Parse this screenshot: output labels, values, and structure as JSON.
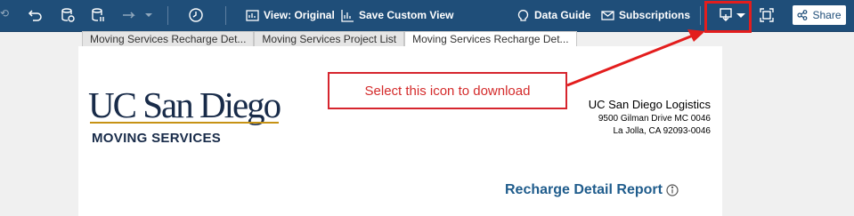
{
  "toolbar": {
    "view_label": "View: Original",
    "save_view_label": "Save Custom View",
    "data_guide_label": "Data Guide",
    "subscriptions_label": "Subscriptions",
    "share_label": "Share",
    "icons": [
      "undo-icon",
      "revert-icon",
      "pause-icon",
      "redo-icon",
      "timer-icon",
      "download-icon",
      "fullscreen-icon",
      "share-icon"
    ]
  },
  "tabs": [
    {
      "label": "Moving Services Recharge Det...",
      "active": false
    },
    {
      "label": "Moving Services Project List",
      "active": false
    },
    {
      "label": "Moving Services Recharge Det...",
      "active": true
    }
  ],
  "logo": {
    "main": "UC San Diego",
    "sub": "MOVING SERVICES"
  },
  "address": {
    "name": "UC San Diego Logistics",
    "line1": "9500 Gilman Drive MC 0046",
    "line2": "La Jolla, CA 92093-0046"
  },
  "callout": {
    "text": "Select this icon to download"
  },
  "report": {
    "title": "Recharge Detail Report"
  },
  "colors": {
    "toolbar_bg": "#1f4e79",
    "callout_red": "#e31d1d",
    "logo_navy": "#182b49",
    "logo_gold": "#c69214",
    "title_blue": "#1f5c8c"
  }
}
